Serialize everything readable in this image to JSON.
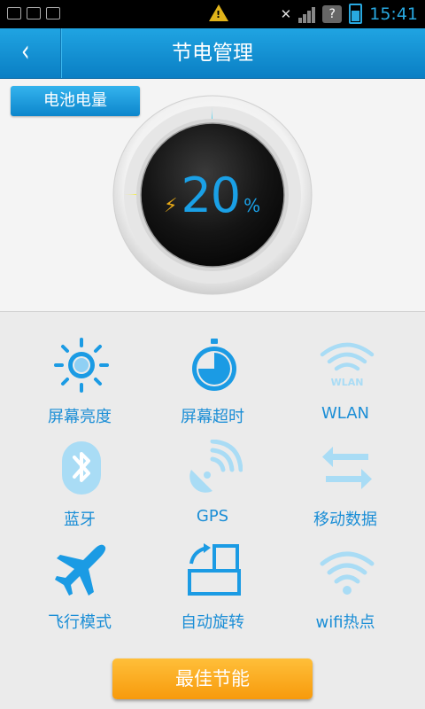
{
  "status_bar": {
    "time": "15:41",
    "icons": [
      "notification-icon",
      "warning-icon",
      "mute-icon",
      "signal-icon",
      "sim-unknown-icon",
      "battery-charging-icon"
    ]
  },
  "header": {
    "back_icon": "‹",
    "title": "节电管理"
  },
  "battery": {
    "label": "电池电量",
    "level_value": "20",
    "level_unit": "%",
    "level_fraction": 0.2,
    "bolt_icon": "⚡",
    "colors": {
      "ring_top": "#2fc8f2",
      "ring_bottom": "#f4ee2c",
      "dial": "#111111",
      "value": "#1aa0e6"
    }
  },
  "toggles": [
    {
      "label": "屏幕亮度",
      "icon": "brightness-icon"
    },
    {
      "label": "屏幕超时",
      "icon": "timeout-icon"
    },
    {
      "label": "WLAN",
      "icon": "wlan-icon",
      "icon_text": "WLAN"
    },
    {
      "label": "蓝牙",
      "icon": "bluetooth-icon"
    },
    {
      "label": "GPS",
      "icon": "gps-icon"
    },
    {
      "label": "移动数据",
      "icon": "mobile-data-icon"
    },
    {
      "label": "飞行模式",
      "icon": "airplane-icon"
    },
    {
      "label": "自动旋转",
      "icon": "auto-rotate-icon"
    },
    {
      "label": "wifi热点",
      "icon": "hotspot-icon"
    }
  ],
  "optimize_button": {
    "label": "最佳节能"
  }
}
